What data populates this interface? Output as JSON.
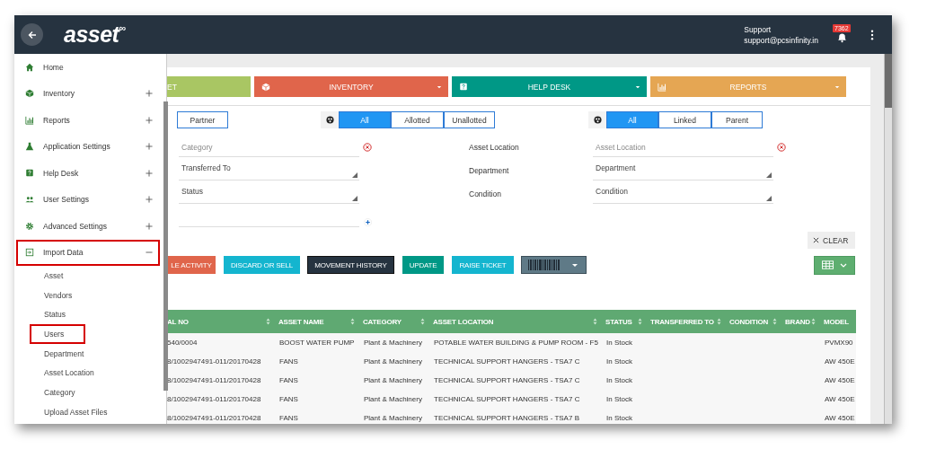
{
  "header": {
    "logo": "asset",
    "logo_mark": "∞",
    "user_name": "Support",
    "user_email": "support@pcsinfinity.in",
    "notification_count": "7362"
  },
  "sidebar": {
    "items": [
      {
        "label": "Home",
        "kind": "link",
        "highlighted": false
      },
      {
        "label": "Inventory",
        "kind": "group",
        "expanded": false,
        "highlighted": false
      },
      {
        "label": "Reports",
        "kind": "group",
        "expanded": false,
        "highlighted": false
      },
      {
        "label": "Application Settings",
        "kind": "group",
        "expanded": false,
        "highlighted": false
      },
      {
        "label": "Help Desk",
        "kind": "group",
        "expanded": false,
        "highlighted": false
      },
      {
        "label": "User Settings",
        "kind": "group",
        "expanded": false,
        "highlighted": false
      },
      {
        "label": "Advanced Settings",
        "kind": "group",
        "expanded": false,
        "highlighted": false
      },
      {
        "label": "Import Data",
        "kind": "group",
        "expanded": true,
        "highlighted": true,
        "children": [
          {
            "label": "Asset",
            "highlighted": false
          },
          {
            "label": "Vendors",
            "highlighted": false
          },
          {
            "label": "Status",
            "highlighted": false
          },
          {
            "label": "Users",
            "highlighted": true
          },
          {
            "label": "Department",
            "highlighted": false
          },
          {
            "label": "Asset Location",
            "highlighted": false
          },
          {
            "label": "Category",
            "highlighted": false
          },
          {
            "label": "Upload Asset Files",
            "highlighted": false
          }
        ]
      }
    ]
  },
  "modules": [
    {
      "label": "ET",
      "color": "#a9c663",
      "dropdown": false
    },
    {
      "label": "INVENTORY",
      "color": "#e0654b",
      "dropdown": true
    },
    {
      "label": "HELP DESK",
      "color": "#009886",
      "dropdown": true
    },
    {
      "label": "REPORTS",
      "color": "#e5a653",
      "dropdown": true
    }
  ],
  "segments": [
    {
      "kind": "plain",
      "options": [
        {
          "label": "Partner",
          "selected": false
        }
      ]
    },
    {
      "kind": "with_icon",
      "options": [
        {
          "label": "All",
          "selected": true
        },
        {
          "label": "Allotted",
          "selected": false
        },
        {
          "label": "Unallotted",
          "selected": false
        }
      ]
    },
    {
      "kind": "with_icon",
      "options": [
        {
          "label": "All",
          "selected": true
        },
        {
          "label": "Linked",
          "selected": false
        },
        {
          "label": "Parent",
          "selected": false
        }
      ]
    }
  ],
  "fields_left": [
    {
      "kind": "text",
      "placeholder": "Category",
      "clearable": true
    },
    {
      "kind": "select",
      "value": "Transferred To"
    },
    {
      "kind": "select",
      "value": "Status"
    },
    {
      "kind": "text",
      "addable": true
    }
  ],
  "fields_right": [
    {
      "label": "Asset Location",
      "kind": "text",
      "placeholder": "Asset Location",
      "clearable": true
    },
    {
      "label": "Department",
      "kind": "select",
      "value": "Department"
    },
    {
      "label": "Condition",
      "kind": "select",
      "value": "Condition"
    }
  ],
  "clear_button": "CLEAR",
  "actions": [
    {
      "kind": "text",
      "label": "LE ACTIVITY",
      "color": "#e0654b"
    },
    {
      "kind": "text",
      "label": "DISCARD OR SELL",
      "color": "#14b5cf"
    },
    {
      "kind": "text",
      "label": "MOVEMENT HISTORY",
      "color": "#263340"
    },
    {
      "kind": "text",
      "label": "UPDATE",
      "color": "#009886"
    },
    {
      "kind": "text",
      "label": "RAISE TICKET",
      "color": "#14b5cf"
    },
    {
      "kind": "barcode",
      "color": "#5f7a87"
    }
  ],
  "table": {
    "columns": [
      {
        "label": "AL NO",
        "sortable": true
      },
      {
        "label": "ASSET NAME",
        "sortable": true
      },
      {
        "label": "CATEGORY",
        "sortable": true
      },
      {
        "label": "ASSET LOCATION",
        "sortable": true
      },
      {
        "label": "STATUS",
        "sortable": true
      },
      {
        "label": "TRANSFERRED TO",
        "sortable": true
      },
      {
        "label": "CONDITION",
        "sortable": true
      },
      {
        "label": "BRAND",
        "sortable": true
      },
      {
        "label": "MODEL",
        "sortable": false
      }
    ],
    "rows": [
      [
        "540/0004",
        "BOOST WATER PUMP",
        "Plant & Machinery",
        "POTABLE WATER BUILDING & PUMP ROOM - F5",
        "In Stock",
        null,
        null,
        null,
        "PVMX90"
      ],
      [
        "8/1002947491-011/20170428",
        "FANS",
        "Plant & Machinery",
        "TECHNICAL SUPPORT HANGERS - TSA7 C",
        "In Stock",
        null,
        null,
        null,
        "AW 450E"
      ],
      [
        "8/1002947491-011/20170428",
        "FANS",
        "Plant & Machinery",
        "TECHNICAL SUPPORT HANGERS - TSA7 C",
        "In Stock",
        null,
        null,
        null,
        "AW 450E"
      ],
      [
        "8/1002947491-011/20170428",
        "FANS",
        "Plant & Machinery",
        "TECHNICAL SUPPORT HANGERS - TSA7 C",
        "In Stock",
        null,
        null,
        null,
        "AW 450E"
      ],
      [
        "8/1002947491-011/20170428",
        "FANS",
        "Plant & Machinery",
        "TECHNICAL SUPPORT HANGERS - TSA7 B",
        "In Stock",
        null,
        null,
        null,
        "AW 450E"
      ]
    ]
  }
}
